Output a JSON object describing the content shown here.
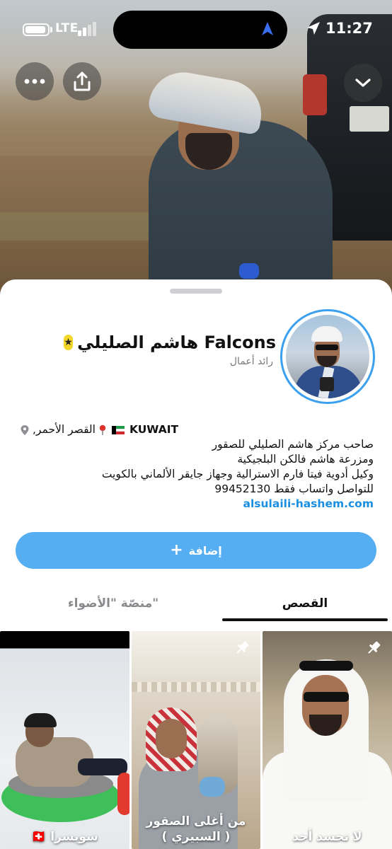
{
  "status_bar": {
    "network": "LTE",
    "time": "11:27"
  },
  "profile": {
    "name": "هاشم الصليلي Falcons",
    "subtitle": "رائد أعمال",
    "location_city": "القصر الأحمر,",
    "location_country": "KUWAIT",
    "bio_lines": [
      "صاحب مركز هاشم الصليلي للصقور",
      "ومزرعة هاشم فالكن البلجيكية",
      "وكيل أدوية فيتا فارم الاسترالية وجهاز جايقر الألماني بالكويت",
      "للتواصل واتساب فقط 99452130"
    ],
    "website": "alsulaili-hashem.com"
  },
  "actions": {
    "add_label": "إضافة"
  },
  "tabs": {
    "stories": "القصص",
    "spotlight": "منصّة \"الأضواء\""
  },
  "stories": [
    {
      "caption": "سويسرا 🇨🇭",
      "pinned": false
    },
    {
      "caption": "من أغلى الصقور ( السبيري )",
      "pinned": true
    },
    {
      "caption": "لا تحسد أحد",
      "pinned": true
    }
  ],
  "colors": {
    "accent_blue": "#55aef2",
    "link_blue": "#1a8fe0",
    "avatar_ring": "#3ba0f0",
    "badge_yellow": "#f2d72a"
  },
  "icons": [
    "battery-icon",
    "signal-icon",
    "location-arrow-icon",
    "more-icon",
    "share-icon",
    "chevron-down-icon",
    "star-badge-icon",
    "map-pin-icon",
    "kuwait-flag-icon",
    "pin-icon",
    "plus-icon"
  ]
}
